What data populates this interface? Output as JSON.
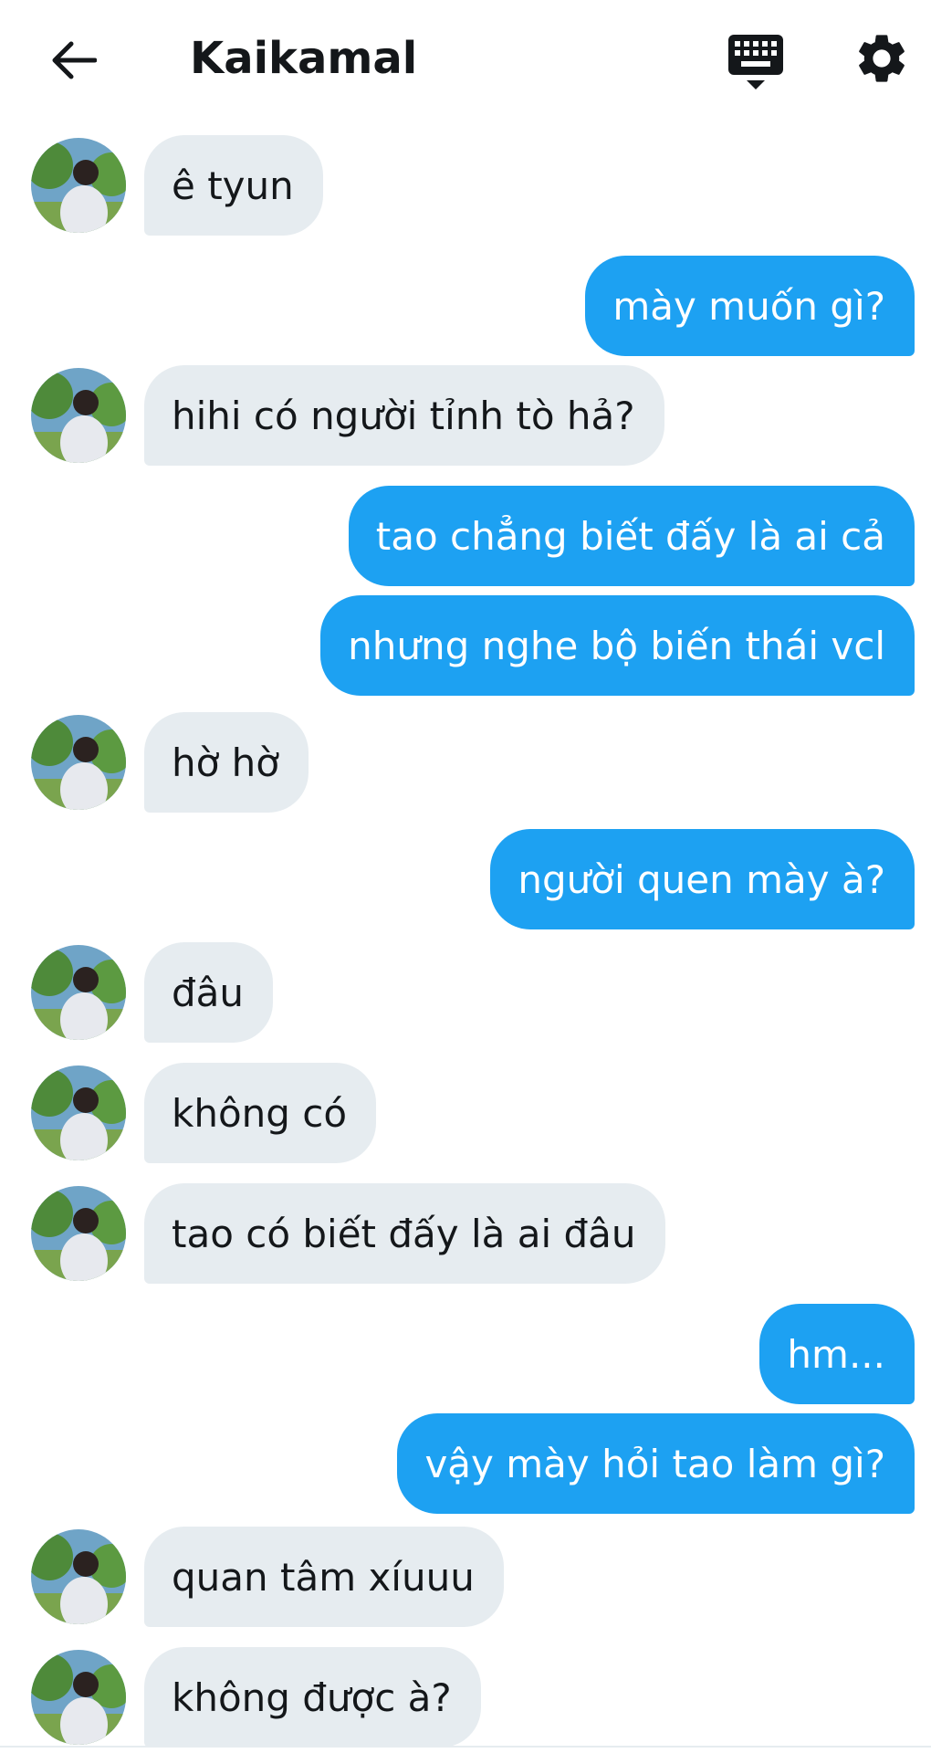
{
  "header": {
    "title": "Kaikamal",
    "back_icon": "arrow-left-icon",
    "keyboard_icon": "keyboard-icon",
    "settings_icon": "gear-icon"
  },
  "colors": {
    "incoming_bubble": "#e6ecf0",
    "outgoing_bubble": "#1da1f2",
    "text": "#14171a"
  },
  "messages": [
    {
      "dir": "in",
      "text": "ê tyun"
    },
    {
      "dir": "out",
      "text": "mày muốn gì?"
    },
    {
      "dir": "in",
      "text": "hihi có người tỉnh tò hả?"
    },
    {
      "dir": "out",
      "text": "tao chẳng biết đấy là ai cả"
    },
    {
      "dir": "out",
      "text": "nhưng nghe bộ biến thái vcl"
    },
    {
      "dir": "in",
      "text": "hờ hờ"
    },
    {
      "dir": "out",
      "text": "người quen mày à?"
    },
    {
      "dir": "in",
      "text": "đâu"
    },
    {
      "dir": "in",
      "text": "không có"
    },
    {
      "dir": "in",
      "text": "tao có biết đấy là ai đâu"
    },
    {
      "dir": "out",
      "text": "hm..."
    },
    {
      "dir": "out",
      "text": "vậy mày hỏi tao làm gì?"
    },
    {
      "dir": "in",
      "text": "quan tâm xíuuu"
    },
    {
      "dir": "in",
      "text": "không được à?"
    }
  ]
}
